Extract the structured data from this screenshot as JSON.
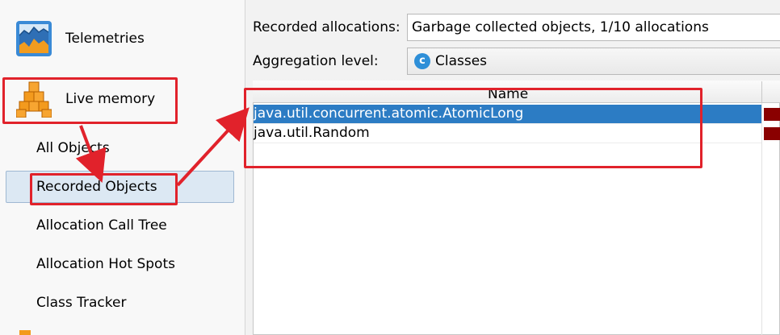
{
  "sidebar": {
    "sections": [
      {
        "label": "Telemetries",
        "icon": "telemetries-chart-icon"
      },
      {
        "label": "Live memory",
        "icon": "live-memory-cubes-icon"
      }
    ],
    "items": [
      {
        "label": "All Objects"
      },
      {
        "label": "Recorded Objects",
        "selected": true
      },
      {
        "label": "Allocation Call Tree"
      },
      {
        "label": "Allocation Hot Spots"
      },
      {
        "label": "Class Tracker"
      }
    ]
  },
  "main": {
    "recorded_allocations": {
      "label": "Recorded allocations:",
      "value": "Garbage collected objects, 1/10 allocations"
    },
    "aggregation_level": {
      "label": "Aggregation level:",
      "value": "Classes",
      "icon_letter": "c"
    },
    "table": {
      "columns": [
        "Name"
      ],
      "rows": [
        {
          "name": "java.util.concurrent.atomic.AtomicLong",
          "selected": true
        },
        {
          "name": "java.util.Random",
          "selected": false
        }
      ]
    }
  },
  "colors": {
    "selection": "#2c7cc4",
    "annotation": "#e1222b",
    "bar": "#8a0000"
  }
}
